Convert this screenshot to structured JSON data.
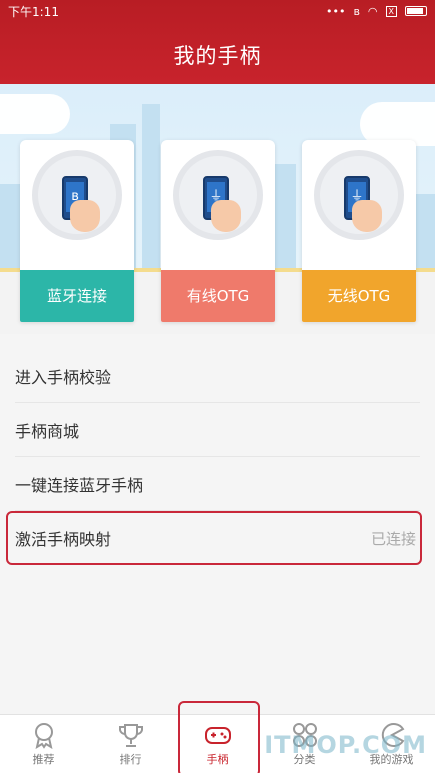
{
  "status": {
    "time": "下午1:11",
    "sim": "X"
  },
  "header": {
    "title": "我的手柄"
  },
  "cards": [
    {
      "label": "蓝牙连接",
      "color": "#2cb6a8",
      "icon": "bluetooth-icon"
    },
    {
      "label": "有线OTG",
      "color": "#ef7a6b",
      "icon": "usb-icon"
    },
    {
      "label": "无线OTG",
      "color": "#f1a52c",
      "icon": "usb-icon"
    }
  ],
  "menu": {
    "items": [
      {
        "label": "进入手柄校验"
      },
      {
        "label": "手柄商城"
      },
      {
        "label": "一键连接蓝牙手柄"
      },
      {
        "label": "激活手柄映射",
        "value": "已连接"
      }
    ]
  },
  "tabs": [
    {
      "label": "推荐",
      "icon": "medal-icon"
    },
    {
      "label": "排行",
      "icon": "trophy-icon"
    },
    {
      "label": "手柄",
      "icon": "gamepad-icon"
    },
    {
      "label": "分类",
      "icon": "grid-icon"
    },
    {
      "label": "我的游戏",
      "icon": "pacman-icon"
    }
  ],
  "watermark": "ITMOP.COM",
  "colors": {
    "brand": "#c8232c",
    "highlight": "#c9283a"
  }
}
